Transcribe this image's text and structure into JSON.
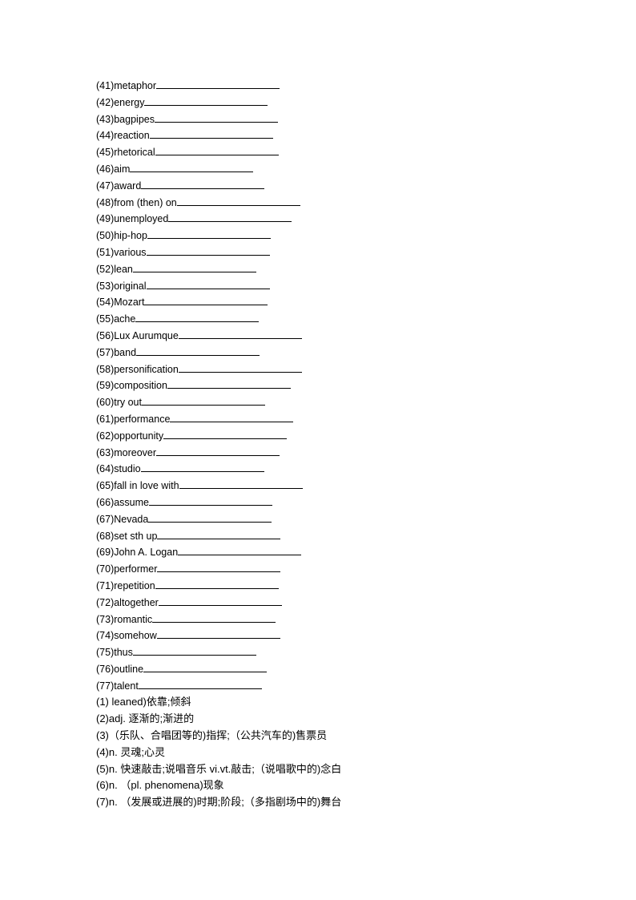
{
  "vocab_items": [
    {
      "label": "(41)metaphor"
    },
    {
      "label": "(42)energy"
    },
    {
      "label": "(43)bagpipes"
    },
    {
      "label": "(44)reaction"
    },
    {
      "label": "(45)rhetorical"
    },
    {
      "label": "(46)aim"
    },
    {
      "label": "(47)award"
    },
    {
      "label": "(48)from (then) on"
    },
    {
      "label": "(49)unemployed"
    },
    {
      "label": "(50)hip-hop"
    },
    {
      "label": "(51)various"
    },
    {
      "label": "(52)lean"
    },
    {
      "label": "(53)original"
    },
    {
      "label": "(54)Mozart"
    },
    {
      "label": "(55)ache"
    },
    {
      "label": "(56)Lux Aurumque"
    },
    {
      "label": "(57)band"
    },
    {
      "label": "(58)personification"
    },
    {
      "label": "(59)composition"
    },
    {
      "label": "(60)try out"
    },
    {
      "label": "(61)performance"
    },
    {
      "label": "(62)opportunity"
    },
    {
      "label": "(63)moreover"
    },
    {
      "label": "(64)studio"
    },
    {
      "label": "(65)fall in love with"
    },
    {
      "label": "(66)assume"
    },
    {
      "label": "(67)Nevada"
    },
    {
      "label": "(68)set sth up"
    },
    {
      "label": "(69)John A. Logan"
    },
    {
      "label": "(70)performer"
    },
    {
      "label": "(71)repetition"
    },
    {
      "label": "(72)altogether"
    },
    {
      "label": "(73)romantic"
    },
    {
      "label": "(74)somehow"
    },
    {
      "label": "(75)thus"
    },
    {
      "label": "(76)outline"
    },
    {
      "label": "(77)talent"
    }
  ],
  "answers": [
    "(1) leaned)依靠;倾斜",
    "(2)adj.  逐渐的;渐进的",
    "(3)（乐队、合唱团等的)指挥;（公共汽车的)售票员",
    "(4)n.  灵魂;心灵",
    "(5)n.  快速敲击;说唱音乐  vi.vt.敲击;（说唱歌中的)念白",
    "(6)n.  （pl. phenomena)现象",
    "(7)n.  （发展或进展的)时期;阶段;（多指剧场中的)舞台"
  ]
}
